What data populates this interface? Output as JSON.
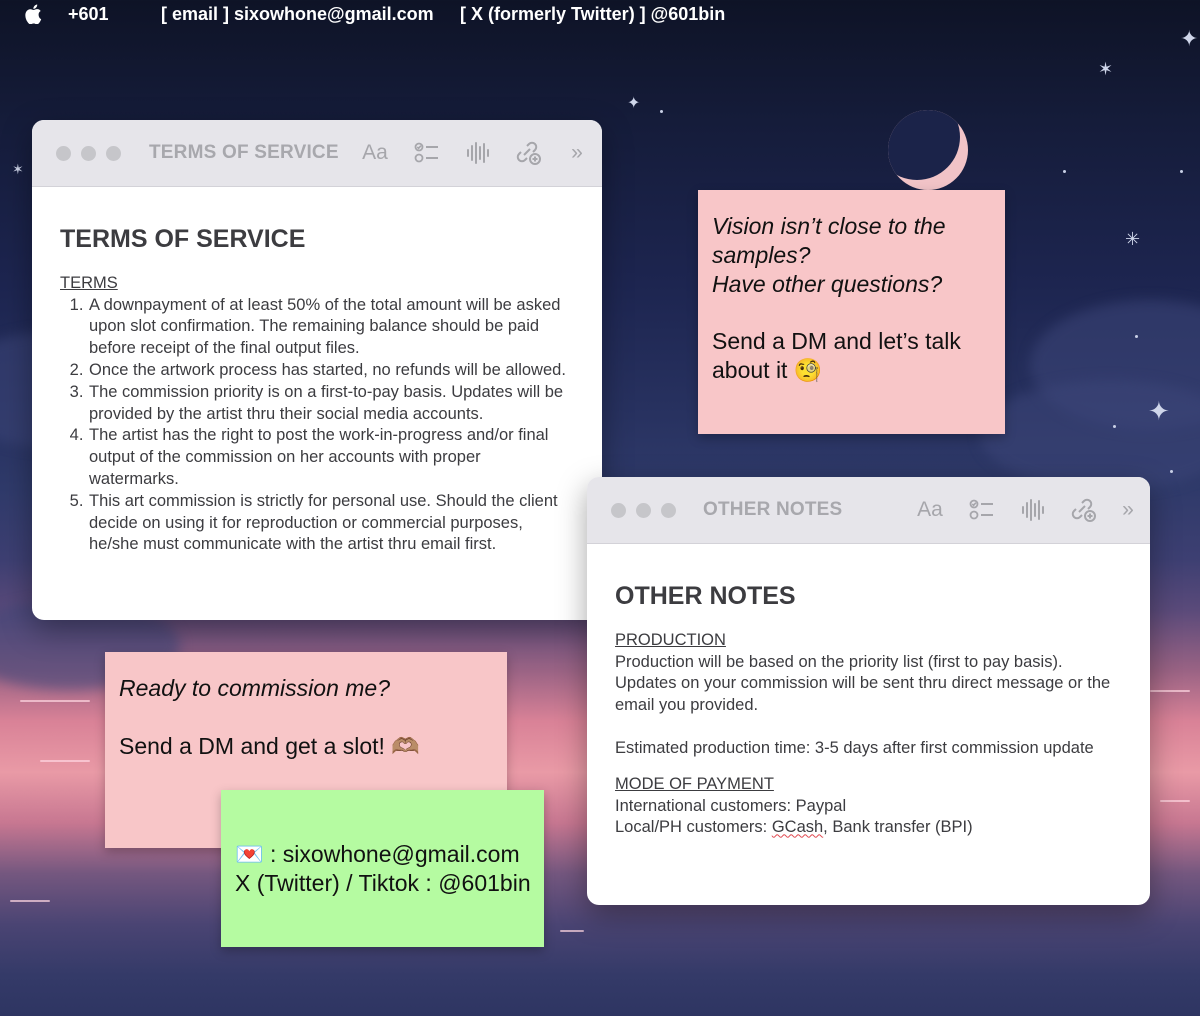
{
  "menubar": {
    "apple_icon": "apple-logo-icon",
    "app_name": "+601",
    "email_item": "[ email ]  sixowhone@gmail.com",
    "twitter_item": "[ X (formerly Twitter) ] @601bin"
  },
  "terms_window": {
    "title": "TERMS OF SERVICE",
    "toolbar": {
      "format_label": "Aa",
      "icons": [
        "checklist-icon",
        "audio-icon",
        "collaborate-icon",
        "more-icon"
      ]
    },
    "heading": "TERMS OF SERVICE",
    "section_label": "TERMS",
    "items": [
      "A downpayment of at least 50% of the total amount will be asked upon slot confirmation. The remaining balance should be paid before receipt of the final output files.",
      "Once the artwork process has started, no refunds will be allowed.",
      "The commission priority is on a first-to-pay basis. Updates will be provided by the artist thru their social media accounts.",
      "The artist has the right to post the work-in-progress and/or final output of the commission on her accounts with proper watermarks.",
      "This art commission is strictly for personal use. Should the client decide on using it for reproduction or commercial purposes, he/she must communicate with the artist thru email first."
    ]
  },
  "notes_window": {
    "title": "OTHER NOTES",
    "toolbar": {
      "format_label": "Aa"
    },
    "heading": "OTHER NOTES",
    "production_label": "PRODUCTION",
    "production_text": "Production will be based on the priority list (first to pay basis). Updates on your commission will be sent thru direct message or the email you provided.",
    "estimate_text": "Estimated production time: 3-5 days after first commission update",
    "payment_label": "MODE OF PAYMENT",
    "international": "International customers: Paypal",
    "local_prefix": "Local/PH customers: ",
    "local_gcash": "GCash",
    "local_suffix": ", Bank transfer (BPI)"
  },
  "sticky_vision": {
    "line1": "Vision isn’t close to the",
    "line2": "samples?",
    "line3": "Have other questions?",
    "line4": "Send a DM and let’s talk",
    "line5": "about it 🧐"
  },
  "sticky_ready": {
    "line1": "Ready to commission me?",
    "line2": "Send a DM and get a slot! 🫶🏽"
  },
  "sticky_contact": {
    "email_line": "💌 : sixowhone@gmail.com",
    "social_line": "X (Twitter) / Tiktok : @601bin"
  }
}
